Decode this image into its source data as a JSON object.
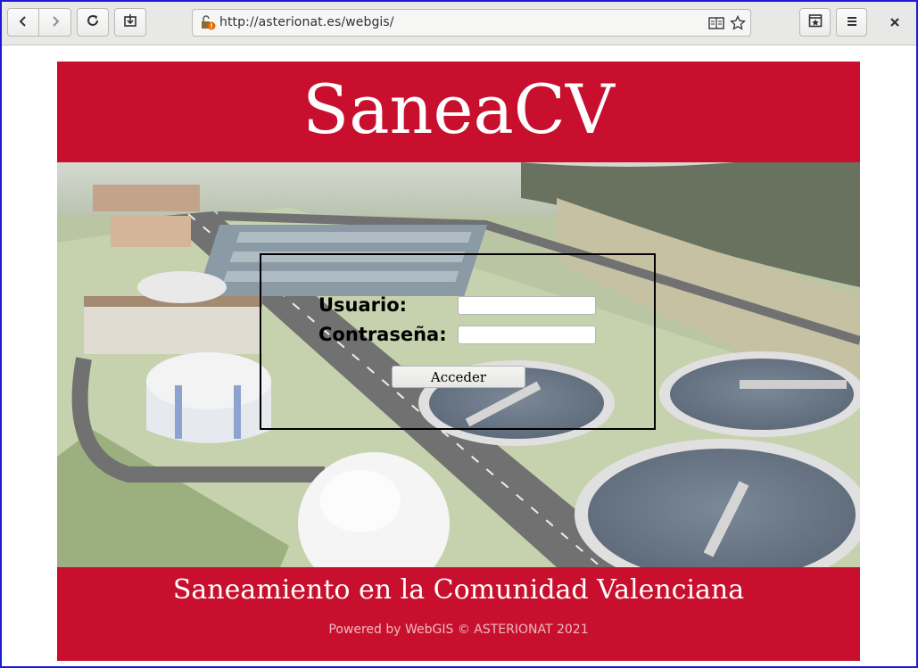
{
  "browser": {
    "url": "http://asterionat.es/webgis/",
    "buttons": {
      "back": "back-icon",
      "forward": "forward-icon",
      "reload": "reload-icon",
      "screenshot": "screenshot-icon",
      "reader": "reader-view-icon",
      "bookmark": "star-icon",
      "save": "save-page-icon",
      "menu": "hamburger-menu-icon",
      "close": "close-icon"
    }
  },
  "site": {
    "title": "SaneaCV",
    "subtitle": "Saneamiento en la Comunidad Valenciana",
    "powered_by": "Powered by WebGIS © ASTERIONAT 2021",
    "brand_color": "#c8102e"
  },
  "login": {
    "user_label": "Usuario:",
    "user_value": "",
    "password_label": "Contraseña:",
    "password_value": "",
    "submit_label": "Acceder"
  }
}
